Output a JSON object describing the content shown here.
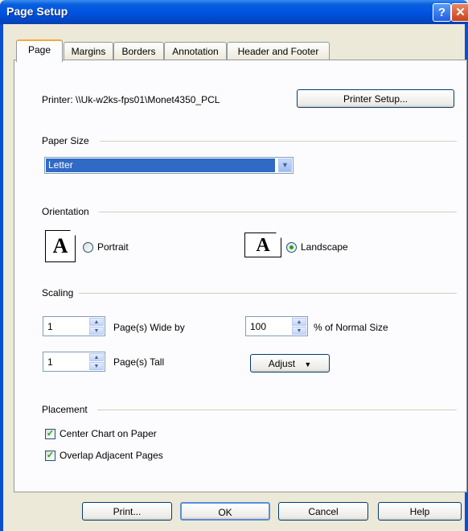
{
  "window": {
    "title": "Page Setup",
    "help_glyph": "?",
    "close_glyph": "✕"
  },
  "tabs": [
    {
      "label": "Page"
    },
    {
      "label": "Margins"
    },
    {
      "label": "Borders"
    },
    {
      "label": "Annotation"
    },
    {
      "label": "Header and Footer"
    }
  ],
  "printer": {
    "label": "Printer: \\\\Uk-w2ks-fps01\\Monet4350_PCL",
    "setup_button": "Printer Setup..."
  },
  "paper_size": {
    "group_label": "Paper Size",
    "selected": "Letter"
  },
  "orientation": {
    "group_label": "Orientation",
    "portrait_label": "Portrait",
    "landscape_label": "Landscape",
    "icon_letter": "A",
    "selected": "Landscape"
  },
  "scaling": {
    "group_label": "Scaling",
    "pages_wide_value": "1",
    "pages_wide_label": "Page(s) Wide by",
    "pages_tall_value": "1",
    "pages_tall_label": "Page(s) Tall",
    "percent_value": "100",
    "percent_label": "% of Normal Size",
    "adjust_button": "Adjust"
  },
  "placement": {
    "group_label": "Placement",
    "center_chart_label": "Center Chart on Paper",
    "center_chart_checked": true,
    "overlap_label": "Overlap Adjacent Pages",
    "overlap_checked": true
  },
  "buttons": {
    "print": "Print...",
    "ok": "OK",
    "cancel": "Cancel",
    "help": "Help"
  },
  "colors": {
    "titlebar": "#0054e3",
    "accent_check": "#21a121",
    "selection": "#316ac5"
  }
}
